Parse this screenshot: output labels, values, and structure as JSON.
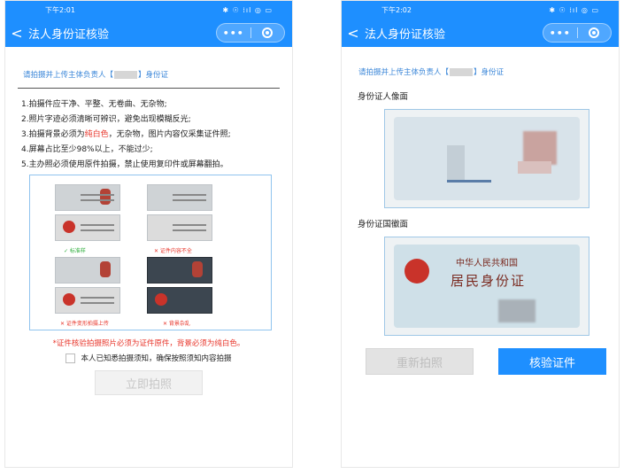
{
  "left": {
    "status": {
      "time": "下午2:01",
      "icons": "✱ ☉ ⁞ıl ◎ ▭"
    },
    "nav": {
      "back": "<",
      "title": "法人身份证核验",
      "more": "•••"
    },
    "prompt": {
      "before": "请拍摄并上传主体负责人【",
      "after": "】身份证"
    },
    "rules": [
      "1.拍摄件应干净、平整、无卷曲、无杂物;",
      "2.照片字迹必须清晰可辨识，避免出现模糊反光;",
      {
        "pre": "3.拍摄背景必须为",
        "red": "纯白色",
        "post": "，无杂物，图片内容仅采集证件照;"
      },
      "4.屏幕占比至少98%以上，不能过少;",
      "5.主办照必须使用原件拍摄，禁止使用复印件或屏幕翻拍。"
    ],
    "guide": {
      "ok_mark": "✓ 标准样",
      "bad_mark_1": "✕ 证件内容不全",
      "bad_mark_2": "✕ 证件变形拍摄上传",
      "bad_mark_3": "✕ 背景杂乱"
    },
    "notice": "*证件核验拍摄照片必须为证件原件，背景必须为纯白色。",
    "agree_label": "本人已知悉拍摄须知，确保按照须知内容拍摄",
    "capture_button": "立即拍照"
  },
  "right": {
    "status": {
      "time": "下午2:02",
      "icons": "✱ ☉ ⁞ıl ◎ ▭"
    },
    "nav": {
      "back": "<",
      "title": "法人身份证核验",
      "more": "•••"
    },
    "prompt": {
      "before": "请拍摄并上传主体负责人【",
      "after": "】身份证"
    },
    "front_label": "身份证人像面",
    "back_label": "身份证国徽面",
    "card_back_title": "中华人民共和国",
    "card_back_name": "居民身份证",
    "retake_button": "重新拍照",
    "verify_button": "核验证件"
  },
  "colors": {
    "brand": "#1e8fff",
    "alert": "#e8362b",
    "prompt": "#3a86d8"
  }
}
